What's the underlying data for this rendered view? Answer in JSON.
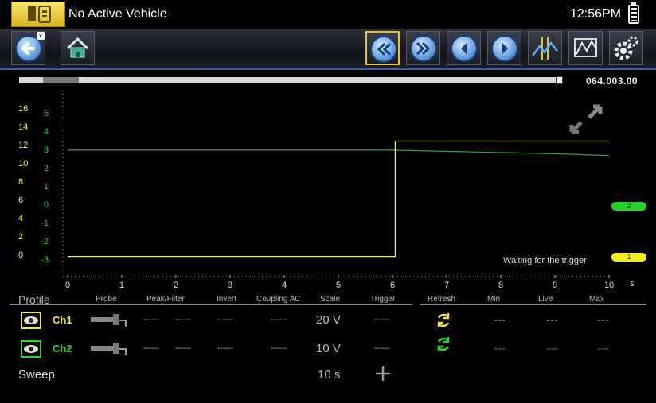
{
  "header": {
    "vehicle": "No Active Vehicle",
    "clock": "12:56PM"
  },
  "playback": {
    "position_fraction": 0.04,
    "timestamp": "064.003.00"
  },
  "graph": {
    "ch1_scale_labels": [
      "16",
      "14",
      "12",
      "10",
      "8",
      "6",
      "4",
      "2",
      "0"
    ],
    "ch2_scale_labels": [
      "5",
      "4",
      "3",
      "2",
      "1",
      "0",
      "-1",
      "-2",
      "-3"
    ],
    "x_ticks": [
      "0",
      "1",
      "2",
      "3",
      "4",
      "5",
      "6",
      "7",
      "8",
      "9",
      "10"
    ],
    "x_unit": "s",
    "status": "Waiting for the trigger",
    "marker_1": "1",
    "marker_2": "2"
  },
  "chart_data": {
    "type": "line",
    "x_range": [
      0,
      10
    ],
    "series": [
      {
        "name": "Ch1",
        "color": "#f3ee5a",
        "x": [
          0,
          5.9,
          5.9,
          6.05,
          6.05,
          10
        ],
        "y": [
          -2.6,
          -2.6,
          -2.6,
          -2.6,
          3.8,
          3.8
        ]
      },
      {
        "name": "Ch2",
        "color": "#2fa53a",
        "x": [
          0,
          6,
          9,
          10
        ],
        "y": [
          3.3,
          3.3,
          3.1,
          3.0
        ]
      }
    ],
    "y_range": [
      -3.5,
      5.5
    ]
  },
  "table": {
    "profile_label": "Profile",
    "headers": [
      "Probe",
      "Peak/Filter",
      "Invert",
      "Coupling AC",
      "Scale",
      "Trigger",
      "Refresh",
      "Min",
      "Live",
      "Max"
    ],
    "rows": [
      {
        "name": "Ch1",
        "color": "#f4e14a",
        "peak": "------",
        "filter": "------",
        "invert": "------",
        "coupling": "------",
        "scale": "20 V",
        "trigger": "------",
        "min": "---",
        "live": "---",
        "max": "---"
      },
      {
        "name": "Ch2",
        "color": "#32d23a",
        "peak": "------",
        "filter": "------",
        "invert": "------",
        "coupling": "------",
        "scale": "10 V",
        "trigger": "------",
        "min": "---",
        "live": "---",
        "max": "---"
      }
    ],
    "sweep_label": "Sweep",
    "sweep_value": "10 s"
  },
  "colors": {
    "ch1": "#f4e14a",
    "ch2": "#32d23a",
    "accent": "#e6c23a"
  },
  "icons": [
    "home-tab-icon",
    "back-icon",
    "home-icon",
    "fast-rewind-icon",
    "fast-forward-icon",
    "step-back-icon",
    "step-forward-icon",
    "cursors-icon",
    "save-capture-icon",
    "settings-icon",
    "eye-icon",
    "probe-icon",
    "refresh-icon",
    "add-icon",
    "battery-icon",
    "zoom-icon"
  ]
}
